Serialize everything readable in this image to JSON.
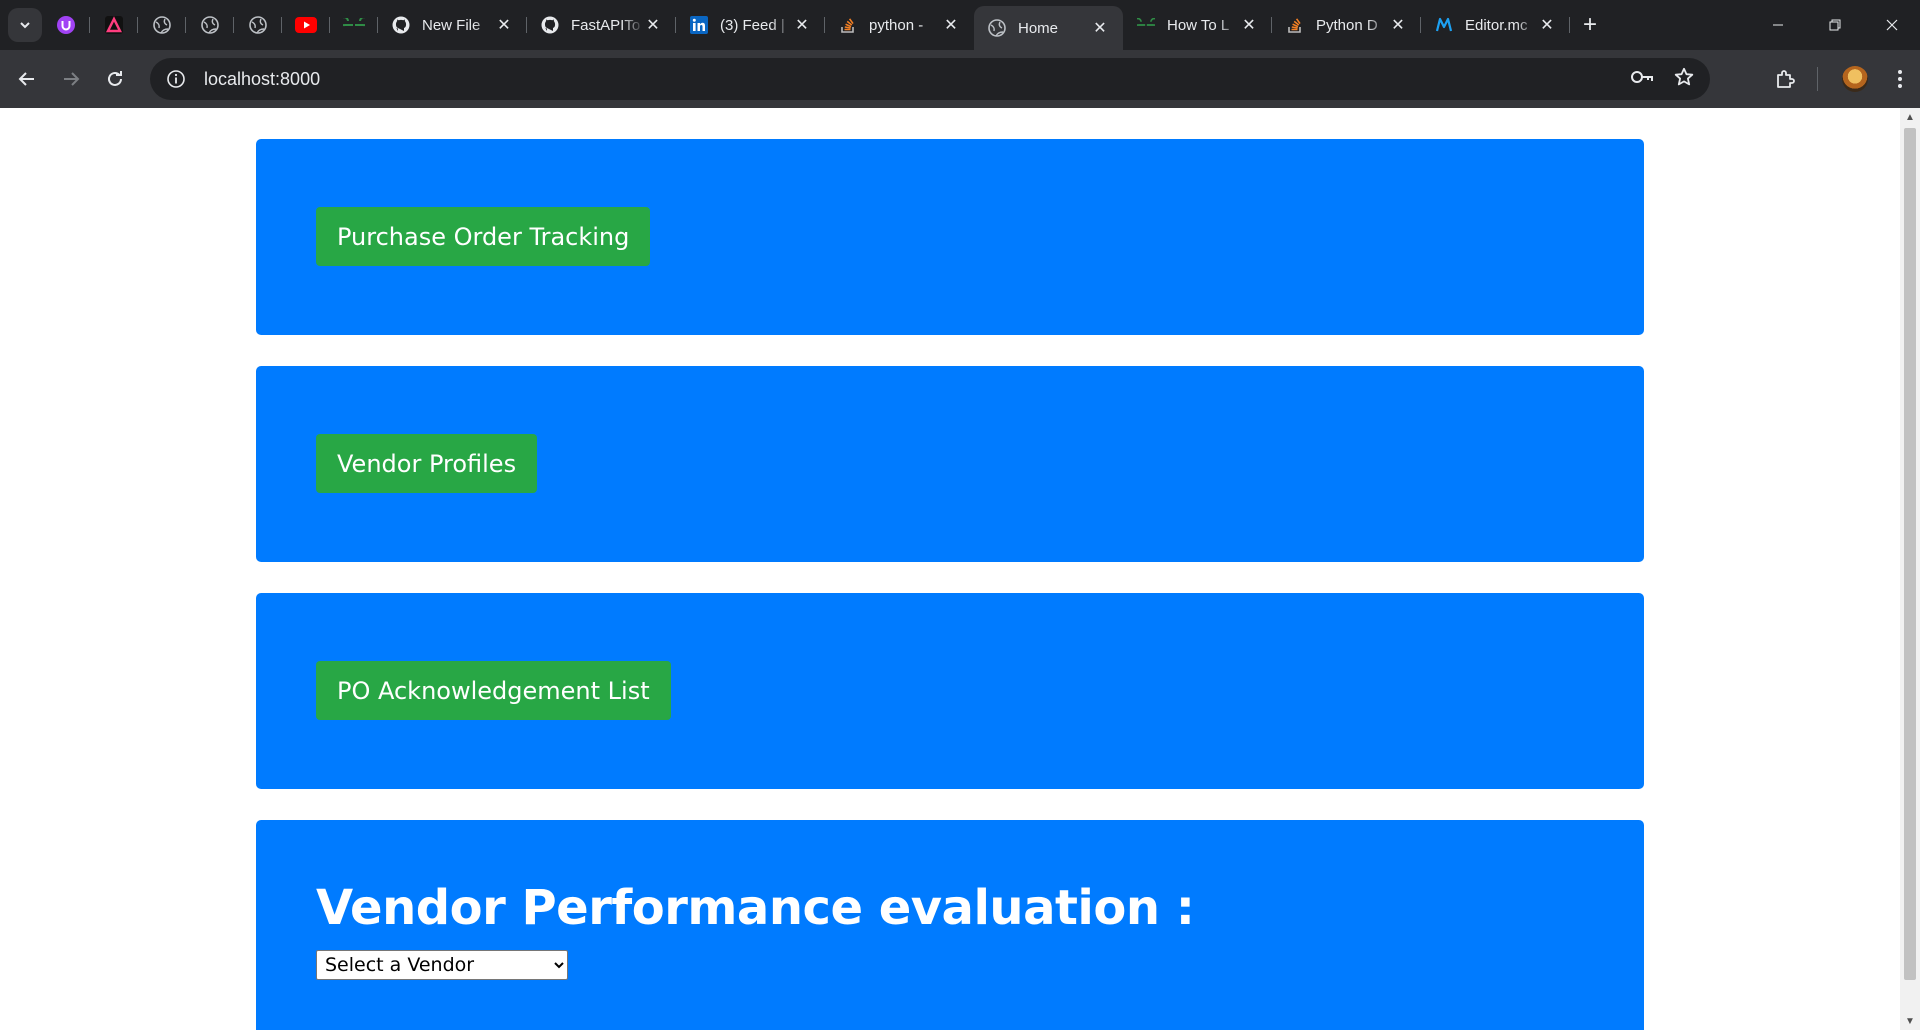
{
  "browser": {
    "tabs": [
      {
        "title": "New File",
        "icon": "github-icon"
      },
      {
        "title": "FastAPITo",
        "icon": "github-icon"
      },
      {
        "title": "(3) Feed |",
        "icon": "linkedin-icon"
      },
      {
        "title": "python -",
        "icon": "stackoverflow-icon"
      },
      {
        "title": "Home",
        "icon": "globe-icon",
        "active": true
      },
      {
        "title": "How To L",
        "icon": "geeksforgeeks-icon"
      },
      {
        "title": "Python D",
        "icon": "stackoverflow-icon"
      },
      {
        "title": "Editor.mc",
        "icon": "medium-icon"
      }
    ],
    "pinned_icons": [
      "purple-u-icon",
      "arc-triangle-icon",
      "globe-icon",
      "globe-icon",
      "globe-icon",
      "youtube-icon",
      "geeksforgeeks-icon"
    ],
    "url": "localhost:8000"
  },
  "page": {
    "buttons": {
      "purchase_order_tracking": "Purchase Order Tracking",
      "vendor_profiles": "Vendor Profiles",
      "po_acknowledgement_list": "PO Acknowledgement List"
    },
    "evaluation": {
      "heading": "Vendor Performance evaluation :",
      "select_value": "Select a Vendor"
    }
  },
  "colors": {
    "card_blue": "#007bff",
    "button_green": "#28a745"
  }
}
